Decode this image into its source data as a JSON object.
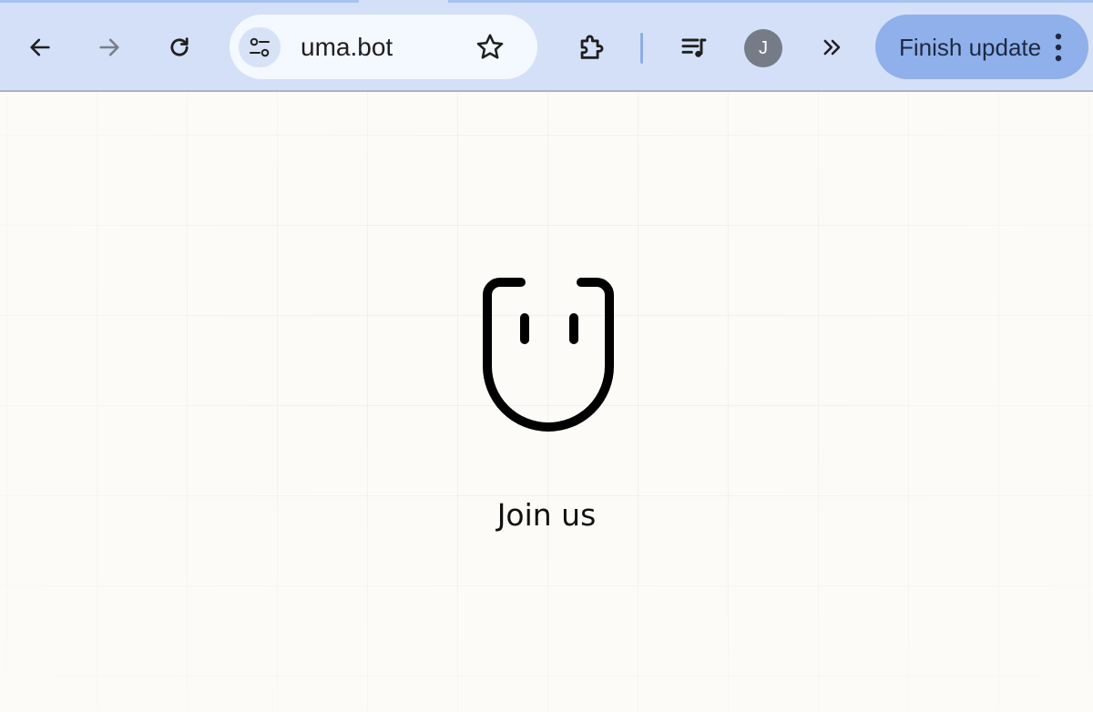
{
  "browser": {
    "toolbar": {
      "back_icon": "arrow-left-icon",
      "forward_icon": "arrow-right-icon",
      "reload_icon": "reload-icon",
      "extensions_icon": "puzzle-icon",
      "media_icon": "playlist-icon",
      "overflow_icon": "chevron-double-right-icon"
    },
    "omnibox": {
      "site_info_icon": "tune-icon",
      "url": "uma.bot",
      "bookmark_icon": "star-icon"
    },
    "profile": {
      "initial": "J"
    },
    "update_button": {
      "label": "Finish update",
      "menu_icon": "kebab-icon"
    },
    "colors": {
      "toolbar_bg": "#d3e0f7",
      "omnibox_bg": "#f4f8ff",
      "update_button_bg": "#8fb0ea",
      "avatar_bg": "#757c88",
      "page_bg": "#fcfbf7"
    }
  },
  "page": {
    "logo_icon": "smiley-cup-logo",
    "cta_label": "Join us"
  }
}
